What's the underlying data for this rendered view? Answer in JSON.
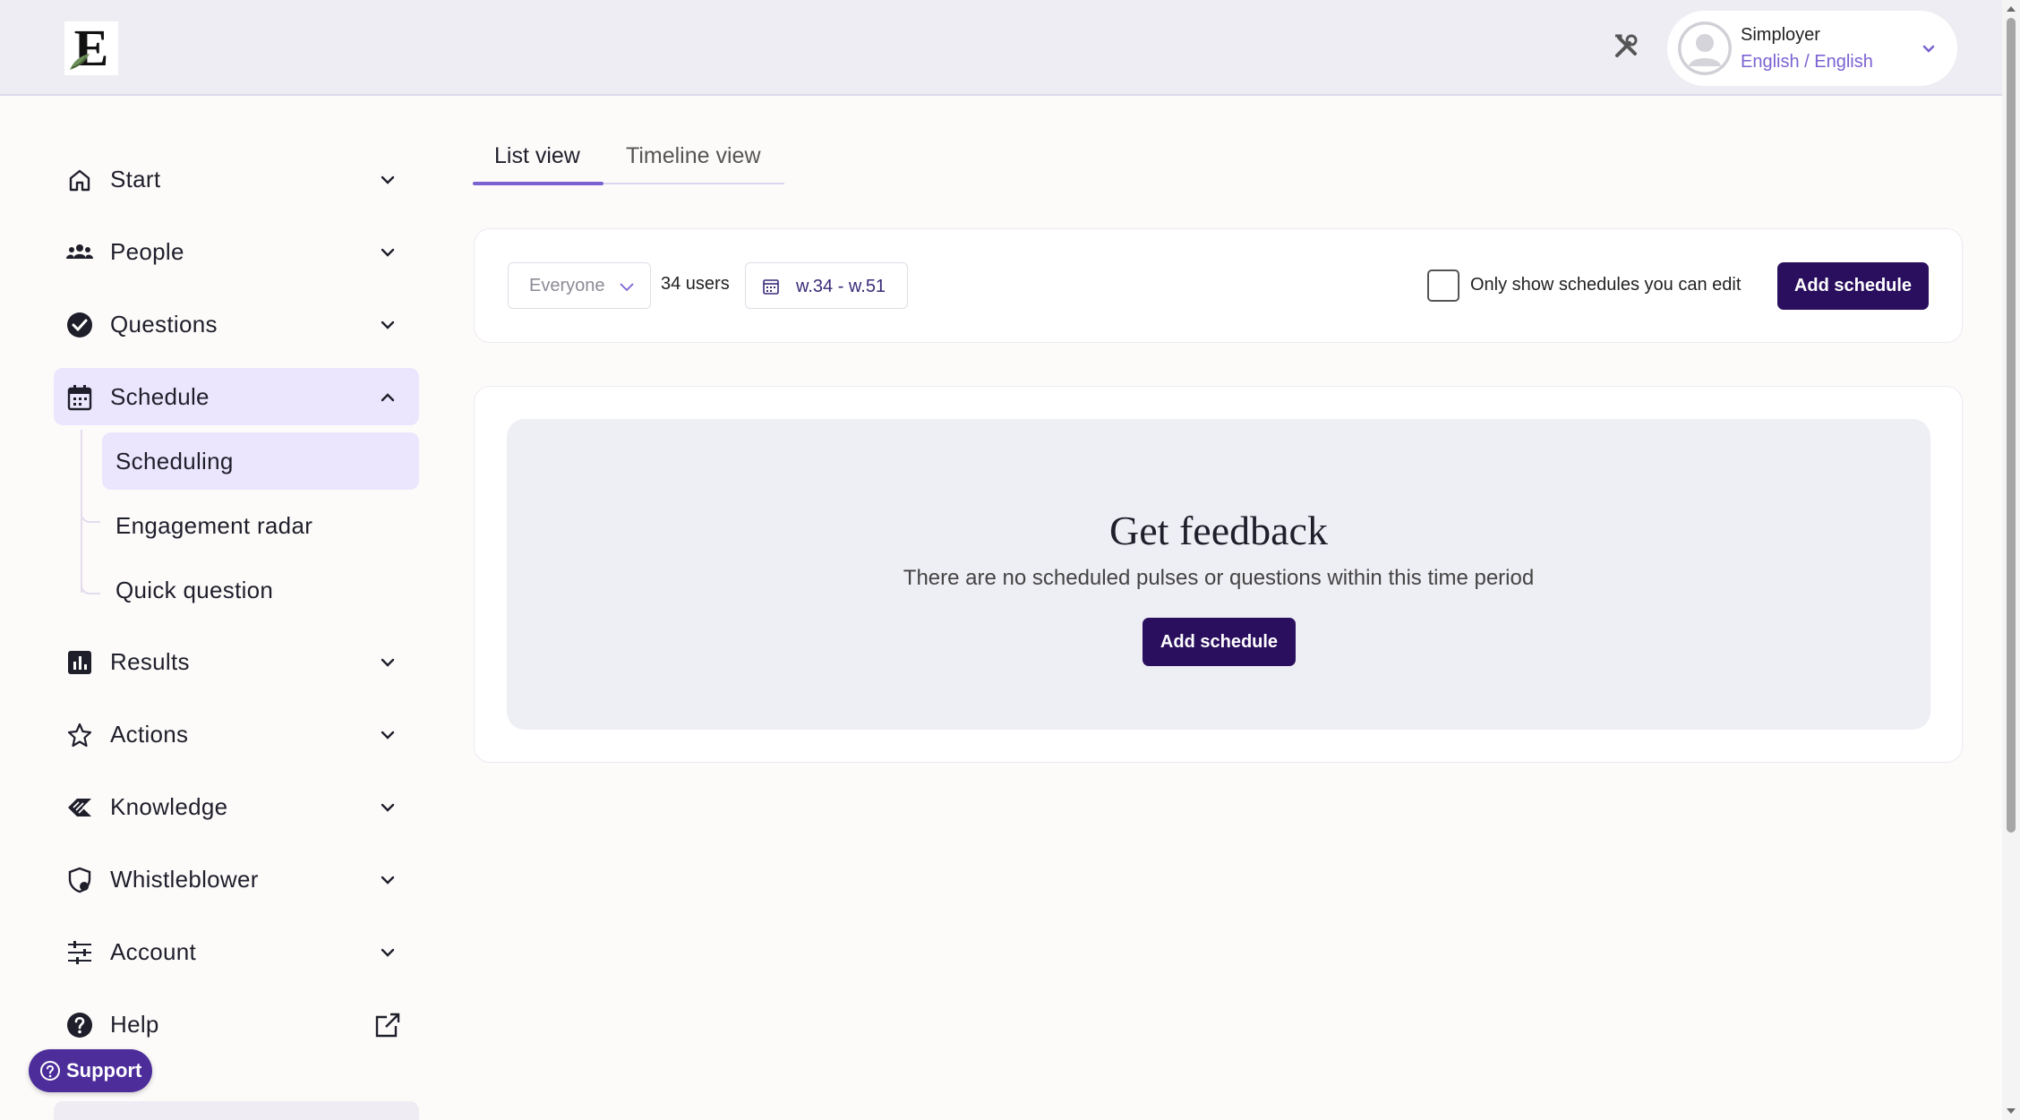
{
  "header": {
    "logo_letter": "E",
    "user": {
      "name": "Simployer",
      "language": "English / English"
    }
  },
  "sidebar": {
    "items": [
      {
        "label": "Start",
        "icon": "home-icon"
      },
      {
        "label": "People",
        "icon": "people-icon"
      },
      {
        "label": "Questions",
        "icon": "check-circle-icon"
      },
      {
        "label": "Schedule",
        "icon": "calendar-icon",
        "expanded": true
      },
      {
        "label": "Results",
        "icon": "bar-chart-icon"
      },
      {
        "label": "Actions",
        "icon": "star-icon"
      },
      {
        "label": "Knowledge",
        "icon": "knowledge-icon"
      },
      {
        "label": "Whistleblower",
        "icon": "shield-icon"
      },
      {
        "label": "Account",
        "icon": "sliders-icon"
      },
      {
        "label": "Help",
        "icon": "help-icon"
      }
    ],
    "schedule_subitems": [
      "Scheduling",
      "Engagement radar",
      "Quick question"
    ],
    "support_label": "Support"
  },
  "tabs": {
    "list": "List view",
    "timeline": "Timeline view",
    "active": "List view"
  },
  "filters": {
    "audience": "Everyone",
    "users_count": "34 users",
    "week_range": "w.34 - w.51",
    "only_editable_label": "Only show schedules you can edit",
    "only_editable_checked": false,
    "add_schedule": "Add schedule"
  },
  "empty_state": {
    "title": "Get feedback",
    "message": "There are no scheduled pulses or questions within this time period",
    "button": "Add schedule"
  },
  "colors": {
    "accent": "#7b62d1",
    "primary_button": "#2a0f5e",
    "active_nav_bg": "#ebe6fd",
    "support_button": "#4c2d9a"
  }
}
